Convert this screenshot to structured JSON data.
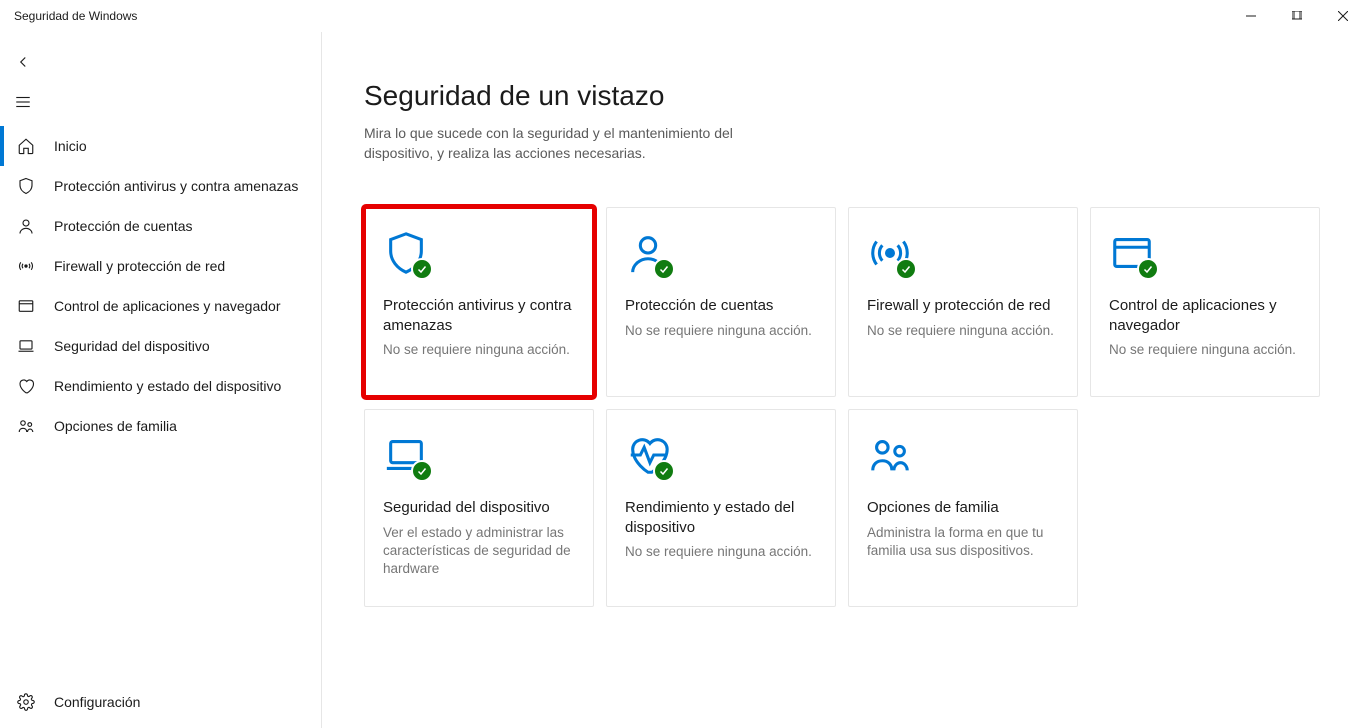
{
  "window": {
    "title": "Seguridad de Windows"
  },
  "sidebar": {
    "items": [
      {
        "label": "Inicio"
      },
      {
        "label": "Protección antivirus y contra amenazas"
      },
      {
        "label": "Protección de cuentas"
      },
      {
        "label": "Firewall y protección de red"
      },
      {
        "label": "Control de aplicaciones y navegador"
      },
      {
        "label": "Seguridad del dispositivo"
      },
      {
        "label": "Rendimiento y estado del dispositivo"
      },
      {
        "label": "Opciones de familia"
      }
    ],
    "settings_label": "Configuración"
  },
  "main": {
    "title": "Seguridad de un vistazo",
    "subtitle": "Mira lo que sucede con la seguridad y el mantenimiento del dispositivo, y realiza las acciones necesarias."
  },
  "tiles": [
    {
      "title": "Protección antivirus y contra amenazas",
      "subtitle": "No se requiere ninguna acción.",
      "status": "ok",
      "highlight": true
    },
    {
      "title": "Protección de cuentas",
      "subtitle": "No se requiere ninguna acción.",
      "status": "ok"
    },
    {
      "title": "Firewall y protección de red",
      "subtitle": "No se requiere ninguna acción.",
      "status": "ok"
    },
    {
      "title": "Control de aplicaciones y navegador",
      "subtitle": "No se requiere ninguna acción.",
      "status": "ok"
    },
    {
      "title": "Seguridad del dispositivo",
      "subtitle": "Ver el estado y administrar las características de seguridad de hardware",
      "status": "ok"
    },
    {
      "title": "Rendimiento y estado del dispositivo",
      "subtitle": "No se requiere ninguna acción.",
      "status": "ok"
    },
    {
      "title": "Opciones de familia",
      "subtitle": "Administra la forma en que tu familia usa sus dispositivos.",
      "status": "none"
    }
  ]
}
